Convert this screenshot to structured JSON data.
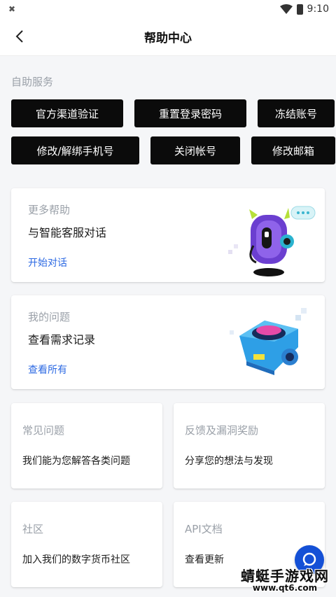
{
  "status_bar": {
    "time": "9:10"
  },
  "header": {
    "title": "帮助中心"
  },
  "self_service": {
    "label": "自助服务",
    "row1": [
      "官方渠道验证",
      "重置登录密码",
      "冻结账号"
    ],
    "row2": [
      "修改/解绑手机号",
      "关闭帐号",
      "修改邮箱"
    ]
  },
  "more_help": {
    "label": "更多帮助",
    "title": "与智能客服对话",
    "link": "开始对话"
  },
  "my_issues": {
    "label": "我的问题",
    "title": "查看需求记录",
    "link": "查看所有"
  },
  "grid": [
    {
      "label": "常见问题",
      "desc": "我们能为您解答各类问题"
    },
    {
      "label": "反馈及漏洞奖励",
      "desc": "分享您的想法与发现"
    },
    {
      "label": "社区",
      "desc": "加入我们的数字货币社区"
    },
    {
      "label": "API文档",
      "desc": "查看更新"
    }
  ],
  "watermark": {
    "line1": "蜻蜓手游戏网",
    "line2": "www.qt6.com"
  },
  "colors": {
    "accent": "#2d6ae3",
    "chip_bg": "#0b0b0b",
    "fab": "#1450d6"
  }
}
